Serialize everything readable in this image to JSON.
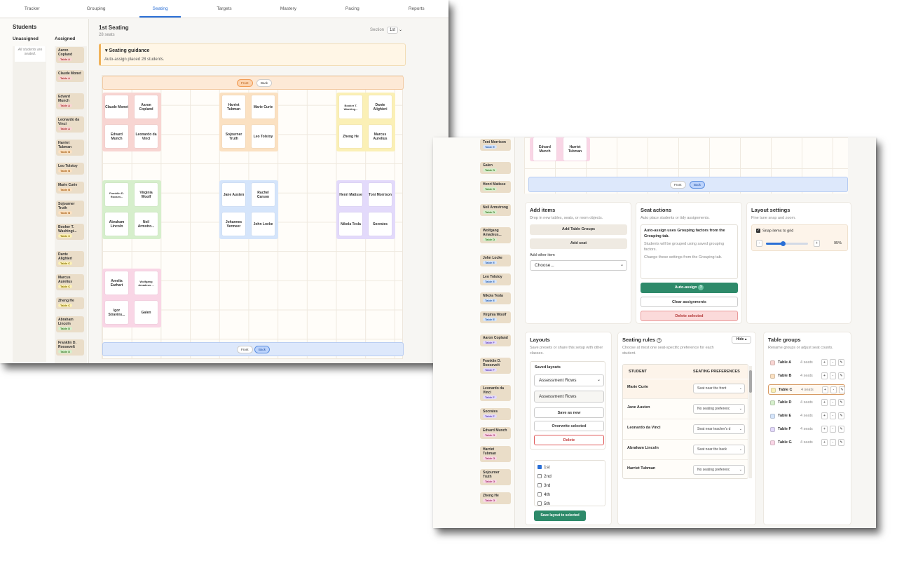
{
  "tabs": [
    "Tracker",
    "Grouping",
    "Seating",
    "Targets",
    "Mastery",
    "Pacing",
    "Reports"
  ],
  "active_tab": "Seating",
  "students_panel": {
    "title": "Students",
    "unassigned_label": "Unassigned",
    "assigned_label": "Assigned",
    "unassigned_note": "All students are seated."
  },
  "assigned_students": [
    {
      "name": "Aaron Copland",
      "table": "Table A"
    },
    {
      "name": "Claude Monet",
      "table": "Table A"
    },
    {
      "name": "Edvard Munch",
      "table": "Table A"
    },
    {
      "name": "Leonardo da Vinci",
      "table": "Table A"
    },
    {
      "name": "Harriet Tubman",
      "table": "Table B"
    },
    {
      "name": "Leo Tolstoy",
      "table": "Table B"
    },
    {
      "name": "Marie Curie",
      "table": "Table B"
    },
    {
      "name": "Sojourner Truth",
      "table": "Table B"
    },
    {
      "name": "Booker T. Washingt...",
      "table": "Table C"
    },
    {
      "name": "Dante Alighieri",
      "table": "Table C"
    },
    {
      "name": "Marcus Aurelius",
      "table": "Table C"
    },
    {
      "name": "Zheng He",
      "table": "Table C"
    },
    {
      "name": "Abraham Lincoln",
      "table": "Table D"
    },
    {
      "name": "Franklin D. Roosevelt",
      "table": "Table D"
    },
    {
      "name": "Neil",
      "table": ""
    }
  ],
  "seating": {
    "title": "1st Seating",
    "seats": "28 seats",
    "section_label": "Section",
    "section_value": "1st",
    "guidance_title": "Seating guidance",
    "guidance_text": "Auto-assign placed 28 students.",
    "front_label": "Front",
    "back_label": "Back"
  },
  "seat_names": {
    "a1": "Claude Monet",
    "a2": "Aaron Copland",
    "a3": "Edvard Munch",
    "a4": "Leonardo da Vinci",
    "b1": "Harriet Tubman",
    "b2": "Marie Curie",
    "b3": "Sojourner Truth",
    "b4": "Leo Tolstoy",
    "c1": "Booker T. Washing...",
    "c2": "Dante Alighieri",
    "c3": "Zheng He",
    "c4": "Marcus Aurelius",
    "d1": "Franklin D. Roosev...",
    "d2": "Virginia Woolf",
    "d3": "Abraham Lincoln",
    "d4": "Neil Armstro...",
    "e1": "Jane Austen",
    "e2": "Rachel Carson",
    "e3": "Johannes Vermeer",
    "e4": "John Locke",
    "f1": "Henri Matisse",
    "f2": "Toni Morrison",
    "f3": "Nikola Tesla",
    "f4": "Socrates",
    "g1": "Amelia Earhart",
    "g2": "Wolfgang Amadeus ...",
    "g3": "Igor Stravins...",
    "g4": "Galen",
    "top1": "Edvard Munch",
    "top2": "Harriet Tubman"
  },
  "sidebar2_students": [
    {
      "name": "Toni Morrison",
      "table": "Table E"
    },
    {
      "name": "Galen",
      "table": "Table D"
    },
    {
      "name": "Henri Matisse",
      "table": "Table D"
    },
    {
      "name": "Neil Armstrong",
      "table": "Table D"
    },
    {
      "name": "Wolfgang Amadeus...",
      "table": "Table D"
    },
    {
      "name": "John Locke",
      "table": "Table E"
    },
    {
      "name": "Leo Tolstoy",
      "table": "Table E"
    },
    {
      "name": "Nikola Tesla",
      "table": "Table E"
    },
    {
      "name": "Virginia Woolf",
      "table": "Table E"
    },
    {
      "name": "Aaron Copland",
      "table": "Table F"
    },
    {
      "name": "Franklin D. Roosevelt",
      "table": "Table F"
    },
    {
      "name": "Leonardo da Vinci",
      "table": "Table F"
    },
    {
      "name": "Socrates",
      "table": "Table F"
    },
    {
      "name": "Edvard Munch",
      "table": "Table G"
    },
    {
      "name": "Harriet Tubman",
      "table": "Table G"
    },
    {
      "name": "Sojourner Truth",
      "table": "Table G"
    },
    {
      "name": "Zheng He",
      "table": "Table G"
    }
  ],
  "add_items": {
    "title": "Add items",
    "desc": "Drop in new tables, seats, or room objects.",
    "add_table_groups": "Add Table Groups",
    "add_seat": "Add seat",
    "other_label": "Add other item",
    "other_value": "Choose..."
  },
  "seat_actions": {
    "title": "Seat actions",
    "desc": "Auto place students or tidy assignments.",
    "info_bold": "Auto-assign uses Grouping factors from the Grouping tab.",
    "info_1": "Students will be grouped using saved grouping factors.",
    "info_2": "Change these settings from the Grouping tab.",
    "auto_assign": "Auto-assign",
    "clear": "Clear assignments",
    "delete": "Delete selected"
  },
  "layout_settings": {
    "title": "Layout settings",
    "desc": "Fine tune snap and zoom.",
    "snap_label": "Snap items to grid",
    "zoom": "95%",
    "zoom_fraction": 0.4
  },
  "layouts": {
    "title": "Layouts",
    "desc": "Save presets or share this setup with other classes.",
    "saved_label": "Saved layouts",
    "selected": "Assessment Rows",
    "name_value": "Assessment Rows",
    "save_new": "Save as new",
    "overwrite": "Overwrite selected",
    "delete": "Delete",
    "sections": [
      {
        "label": "1st",
        "checked": true
      },
      {
        "label": "2nd",
        "checked": false
      },
      {
        "label": "3rd",
        "checked": false
      },
      {
        "label": "4th",
        "checked": false
      },
      {
        "label": "5th",
        "checked": false
      }
    ],
    "save_to_selected": "Save layout to selected"
  },
  "seating_rules": {
    "title": "Seating rules",
    "hide": "Hide",
    "desc": "Choose at most one seat-specific preference for each student.",
    "col_student": "STUDENT",
    "col_pref": "SEATING PREFERENCES",
    "rows": [
      {
        "student": "Marie Curie",
        "pref": "Seat near the front"
      },
      {
        "student": "Jane Austen",
        "pref": "No seating preferenc"
      },
      {
        "student": "Leonardo da Vinci",
        "pref": "Seat near teacher's d"
      },
      {
        "student": "Abraham Lincoln",
        "pref": "Seat near the back"
      },
      {
        "student": "Harriet Tubman",
        "pref": "No seating preferenc"
      }
    ]
  },
  "table_groups": {
    "title": "Table groups",
    "desc": "Rename groups or adjust seat counts.",
    "rows": [
      {
        "name": "Table A",
        "seats": "4 seats",
        "color": "#f8d5d2"
      },
      {
        "name": "Table B",
        "seats": "4 seats",
        "color": "#fbe1c2"
      },
      {
        "name": "Table C",
        "seats": "4 seats",
        "color": "#fbf0b6"
      },
      {
        "name": "Table D",
        "seats": "4 seats",
        "color": "#d6efcc"
      },
      {
        "name": "Table E",
        "seats": "4 seats",
        "color": "#d5e5fb"
      },
      {
        "name": "Table F",
        "seats": "4 seats",
        "color": "#e3dafb"
      },
      {
        "name": "Table G",
        "seats": "4 seats",
        "color": "#f9d6e6"
      }
    ]
  },
  "colors": {
    "accent": "#2a6fd6",
    "green": "#2e8a6a",
    "danger": "#c03b3b"
  }
}
